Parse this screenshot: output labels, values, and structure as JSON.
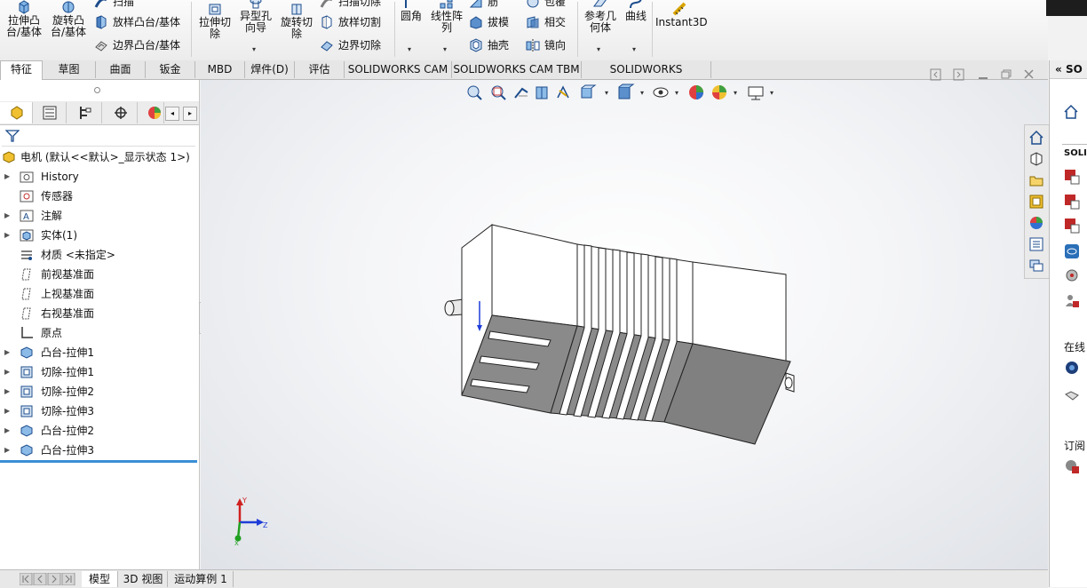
{
  "ribbon": {
    "extrude_boss": "拉伸凸\n台/基体",
    "revolve_boss": "旋转凸\n台/基体",
    "sweep": "扫描",
    "loft_boss": "放样凸台/基体",
    "boundary_boss": "边界凸台/基体",
    "extrude_cut": "拉伸切\n除",
    "hole_wizard": "异型孔\n向导",
    "revolve_cut": "旋转切\n除",
    "sweep_cut": "扫描切除",
    "loft_cut": "放样切割",
    "boundary_cut": "边界切除",
    "fillet": "圆角",
    "linear_pattern": "线性阵\n列",
    "rib": "筋",
    "draft": "拔模",
    "shell": "抽壳",
    "wrap": "包覆",
    "intersect": "相交",
    "mirror": "镜向",
    "reference_geometry": "参考几\n何体",
    "curves": "曲线",
    "instant3d": "Instant3D"
  },
  "tabs": [
    "特征",
    "草图",
    "曲面",
    "钣金",
    "MBD",
    "焊件(D)",
    "评估",
    "SOLIDWORKS CAM",
    "SOLIDWORKS CAM TBM",
    "SOLIDWORKS Inspection"
  ],
  "tree": {
    "root": "电机  (默认<<默认>_显示状态 1>)",
    "items": [
      "History",
      "传感器",
      "注解",
      "实体(1)",
      "材质 <未指定>",
      "前视基准面",
      "上视基准面",
      "右视基准面",
      "原点",
      "凸台-拉伸1",
      "切除-拉伸1",
      "切除-拉伸2",
      "切除-拉伸3",
      "凸台-拉伸2",
      "凸台-拉伸3"
    ]
  },
  "bottom_tabs": [
    "模型",
    "3D 视图",
    "运动算例 1"
  ],
  "taskpane": {
    "header": "SO",
    "solid_label": "SOLI",
    "online_label": "在线",
    "subscribe_label": "订阅"
  },
  "colors": {
    "accent": "#0066cc",
    "model_face_dark": "#808080",
    "model_face_light": "#ffffff"
  }
}
